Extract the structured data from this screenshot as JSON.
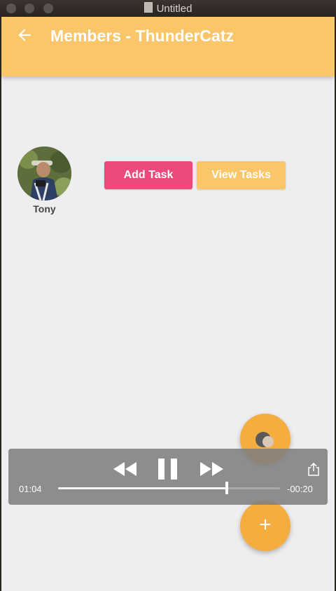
{
  "window": {
    "title": "Untitled"
  },
  "appbar": {
    "title": "Members - ThunderCatz"
  },
  "member": {
    "name": "Tony"
  },
  "actions": {
    "add_task": "Add Task",
    "view_tasks": "View Tasks"
  },
  "player": {
    "elapsed": "01:04",
    "remaining": "-00:20",
    "progress_fraction": 0.76
  },
  "fab": {
    "add_label": "+"
  },
  "colors": {
    "appbar": "#fbc56a",
    "add_task": "#ec4a7a",
    "view_tasks": "#fbc56a",
    "fab": "#f4ad3e",
    "background": "#eeedef"
  },
  "icons": {
    "back": "arrow-back-icon",
    "play_controls": [
      "rewind-icon",
      "pause-icon",
      "fast-forward-icon"
    ],
    "share": "share-icon",
    "fab_top": "avatar-icon",
    "fab_bottom": "plus-icon"
  }
}
